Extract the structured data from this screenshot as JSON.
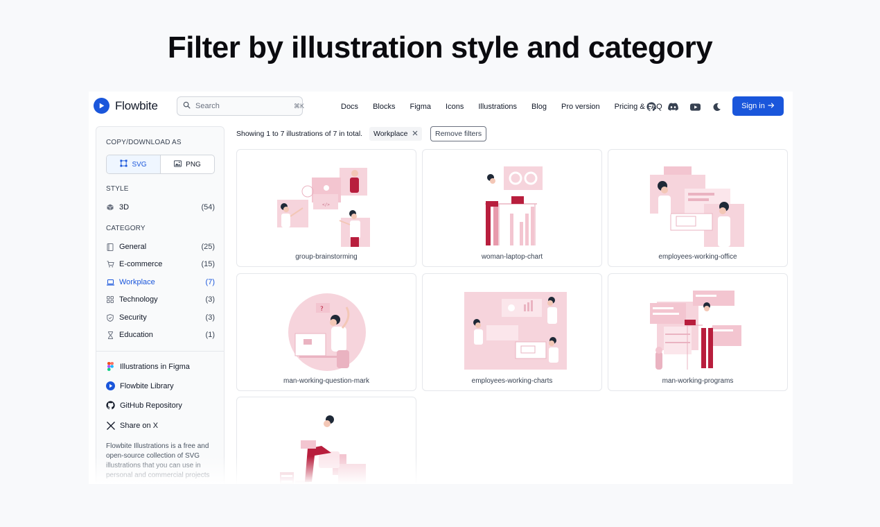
{
  "headline": "Filter by illustration style and category",
  "nav": {
    "brand": "Flowbite",
    "search_placeholder": "Search",
    "search_shortcut": "⌘K",
    "links": [
      "Docs",
      "Blocks",
      "Figma",
      "Icons",
      "Illustrations",
      "Blog",
      "Pro version",
      "Pricing & FAQ"
    ],
    "signin_label": "Sign in",
    "icons": [
      "github-icon",
      "discord-icon",
      "youtube-icon",
      "moon-icon"
    ]
  },
  "sidebar": {
    "copy_title": "COPY/DOWNLOAD AS",
    "formats": [
      "SVG",
      "PNG"
    ],
    "style_title": "STYLE",
    "styles": [
      {
        "label": "3D",
        "count": "(54)"
      }
    ],
    "category_title": "CATEGORY",
    "categories": [
      {
        "label": "General",
        "count": "(25)"
      },
      {
        "label": "E-commerce",
        "count": "(15)"
      },
      {
        "label": "Workplace",
        "count": "(7)"
      },
      {
        "label": "Technology",
        "count": "(3)"
      },
      {
        "label": "Security",
        "count": "(3)"
      },
      {
        "label": "Education",
        "count": "(1)"
      }
    ],
    "links": [
      "Illustrations in Figma",
      "Flowbite Library",
      "GitHub Repository",
      "Share on X"
    ],
    "description": "Flowbite Illustrations is a free and open-source collection of SVG illustrations that you can use in personal and commercial projects"
  },
  "main": {
    "results_text": "Showing 1 to 7 illustrations of 7 in total.",
    "active_filter": "Workplace",
    "remove_filters": "Remove filters",
    "cards": [
      {
        "caption": "group-brainstorming"
      },
      {
        "caption": "woman-laptop-chart"
      },
      {
        "caption": "employees-working-office"
      },
      {
        "caption": "man-working-question-mark"
      },
      {
        "caption": "employees-working-charts"
      },
      {
        "caption": "man-working-programs"
      },
      {
        "caption": ""
      }
    ]
  },
  "colors": {
    "brand": "#1a56db",
    "pink_light": "#f6d4dc",
    "pink_mid": "#eab3c1",
    "crimson": "#b81e3d",
    "skin": "#f3c7b6"
  }
}
